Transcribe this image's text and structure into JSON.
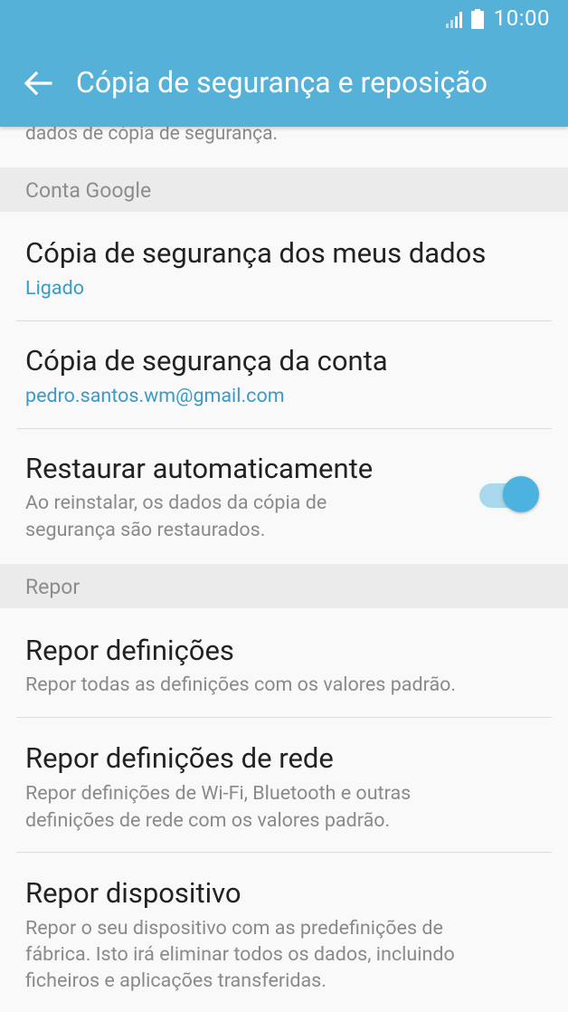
{
  "status_bar": {
    "time": "10:00"
  },
  "app_bar": {
    "title": "Cópia de segurança e reposição"
  },
  "partial_text": "dados de cópia de segurança.",
  "sections": [
    {
      "header": "Conta Google",
      "items": [
        {
          "title": "Cópia de segurança dos meus dados",
          "subtitle": "Ligado"
        },
        {
          "title": "Cópia de segurança da conta",
          "subtitle": "pedro.santos.wm@gmail.com"
        },
        {
          "title": "Restaurar automaticamente",
          "subtitle_line1": "Ao reinstalar, os dados da cópia de",
          "subtitle_line2": "segurança são restaurados.",
          "toggle_on": true
        }
      ]
    },
    {
      "header": "Repor",
      "items": [
        {
          "title": "Repor definições",
          "subtitle": "Repor todas as definições com os valores padrão."
        },
        {
          "title": "Repor definições de rede",
          "subtitle_line1": "Repor definições de Wi-Fi, Bluetooth e outras",
          "subtitle_line2": "definições de rede com os valores padrão."
        },
        {
          "title": "Repor dispositivo",
          "subtitle_line1": "Repor o seu dispositivo com as predefinições de",
          "subtitle_line2": "fábrica. Isto irá eliminar todos os dados, incluindo",
          "subtitle_line3": "ficheiros e aplicações transferidas."
        }
      ]
    }
  ],
  "colors": {
    "app_bar": "#56b1d8",
    "accent": "#3a9bc6",
    "toggle_knob": "#4cb3e0",
    "toggle_track": "#a9d8ec"
  }
}
